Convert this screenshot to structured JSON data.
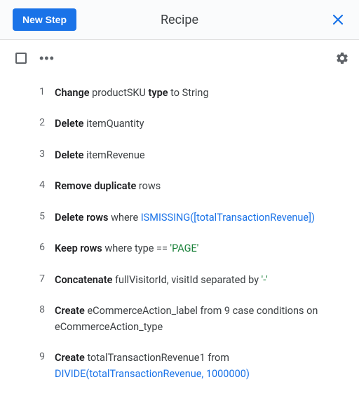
{
  "header": {
    "new_step_label": "New Step",
    "title": "Recipe"
  },
  "steps": [
    {
      "num": "1",
      "parts": [
        {
          "t": "Change ",
          "cls": "bold"
        },
        {
          "t": "productSKU "
        },
        {
          "t": "type ",
          "cls": "bold"
        },
        {
          "t": "to String"
        }
      ]
    },
    {
      "num": "2",
      "parts": [
        {
          "t": "Delete ",
          "cls": "bold"
        },
        {
          "t": "itemQuantity"
        }
      ]
    },
    {
      "num": "3",
      "parts": [
        {
          "t": "Delete ",
          "cls": "bold"
        },
        {
          "t": "itemRevenue"
        }
      ]
    },
    {
      "num": "4",
      "parts": [
        {
          "t": "Remove duplicate ",
          "cls": "bold"
        },
        {
          "t": "rows"
        }
      ]
    },
    {
      "num": "5",
      "parts": [
        {
          "t": "Delete rows ",
          "cls": "bold"
        },
        {
          "t": "where "
        },
        {
          "t": "ISMISSING",
          "cls": "blue"
        },
        {
          "t": "([totalTransactionRevenue])",
          "cls": "blue"
        }
      ]
    },
    {
      "num": "6",
      "parts": [
        {
          "t": "Keep rows ",
          "cls": "bold"
        },
        {
          "t": "where type == "
        },
        {
          "t": "'PAGE'",
          "cls": "green"
        }
      ]
    },
    {
      "num": "7",
      "parts": [
        {
          "t": "Concatenate ",
          "cls": "bold"
        },
        {
          "t": "fullVisitorId, visitId separated by "
        },
        {
          "t": "'-'",
          "cls": "green"
        }
      ]
    },
    {
      "num": "8",
      "parts": [
        {
          "t": "Create ",
          "cls": "bold"
        },
        {
          "t": "eCommerceAction_label from 9 case conditions on eCommerceAction_type"
        }
      ]
    },
    {
      "num": "9",
      "parts": [
        {
          "t": "Create ",
          "cls": "bold"
        },
        {
          "t": "totalTransactionRevenue1 from "
        },
        {
          "t": "DIVIDE",
          "cls": "blue"
        },
        {
          "t": "(totalTransactionRevenue, 1000000)",
          "cls": "blue"
        }
      ]
    }
  ]
}
